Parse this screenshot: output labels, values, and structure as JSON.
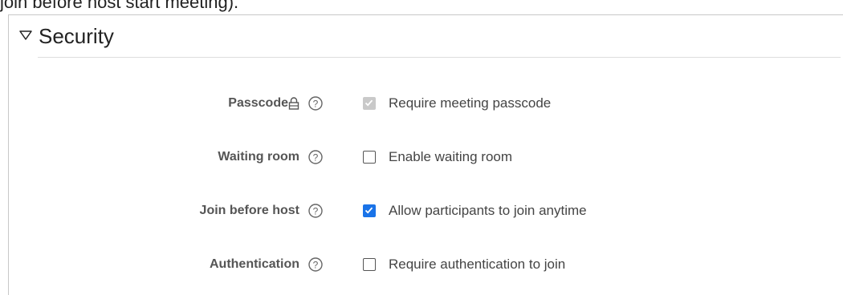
{
  "top_clipped_text": "join before host start meeting).",
  "security": {
    "title": "Security",
    "rows": [
      {
        "label": "Passcode",
        "has_lock": true,
        "checkbox_state": "checked-disabled",
        "option_text": "Require meeting passcode"
      },
      {
        "label": "Waiting room",
        "has_lock": false,
        "checkbox_state": "unchecked",
        "option_text": "Enable waiting room"
      },
      {
        "label": "Join before host",
        "has_lock": false,
        "checkbox_state": "checked",
        "option_text": "Allow participants to join anytime"
      },
      {
        "label": "Authentication",
        "has_lock": false,
        "checkbox_state": "unchecked",
        "option_text": "Require authentication to join"
      }
    ]
  },
  "colors": {
    "checkbox_checked": "#1a73e8",
    "checkbox_disabled": "#c9c9c9",
    "label_text": "#555555",
    "option_text": "#444444"
  },
  "icons": {
    "toggle": "triangle-down-icon",
    "lock": "lock-icon",
    "help": "help-circle-icon"
  }
}
